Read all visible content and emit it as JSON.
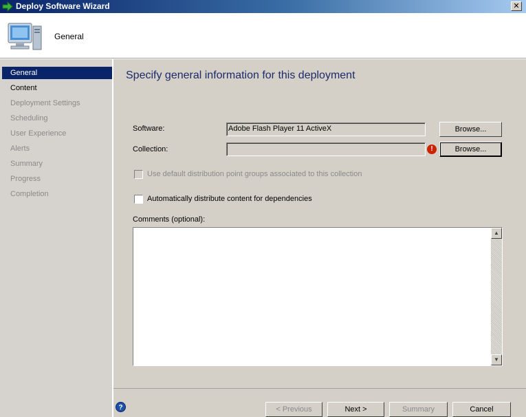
{
  "window": {
    "title": "Deploy Software Wizard",
    "close_label": "✕"
  },
  "header": {
    "title": "General",
    "icon": "computer-icon"
  },
  "sidebar": {
    "items": [
      {
        "label": "General",
        "state": "active"
      },
      {
        "label": "Content",
        "state": "enabled"
      },
      {
        "label": "Deployment Settings",
        "state": "disabled"
      },
      {
        "label": "Scheduling",
        "state": "disabled"
      },
      {
        "label": "User Experience",
        "state": "disabled"
      },
      {
        "label": "Alerts",
        "state": "disabled"
      },
      {
        "label": "Summary",
        "state": "disabled"
      },
      {
        "label": "Progress",
        "state": "disabled"
      },
      {
        "label": "Completion",
        "state": "disabled"
      }
    ]
  },
  "main": {
    "heading": "Specify general information for this deployment",
    "software": {
      "label": "Software:",
      "value": "Adobe Flash Player 11 ActiveX",
      "browse_label": "Browse..."
    },
    "collection": {
      "label": "Collection:",
      "value": "",
      "browse_label": "Browse...",
      "status_icon": "error-icon"
    },
    "default_dp_groups": {
      "label": "Use default distribution point groups associated to this collection",
      "checked": false,
      "enabled": false
    },
    "auto_distribute": {
      "label": "Automatically distribute content for dependencies",
      "checked": false,
      "enabled": true
    },
    "comments": {
      "label": "Comments (optional):",
      "value": ""
    }
  },
  "footer": {
    "previous_label": "< Previous",
    "next_label": "Next >",
    "summary_label": "Summary",
    "cancel_label": "Cancel",
    "help_icon": "help-icon"
  },
  "colors": {
    "title_bar": "#0a246a",
    "active_nav": "#0a246a",
    "heading": "#1c2a6b",
    "error": "#cc2200"
  }
}
